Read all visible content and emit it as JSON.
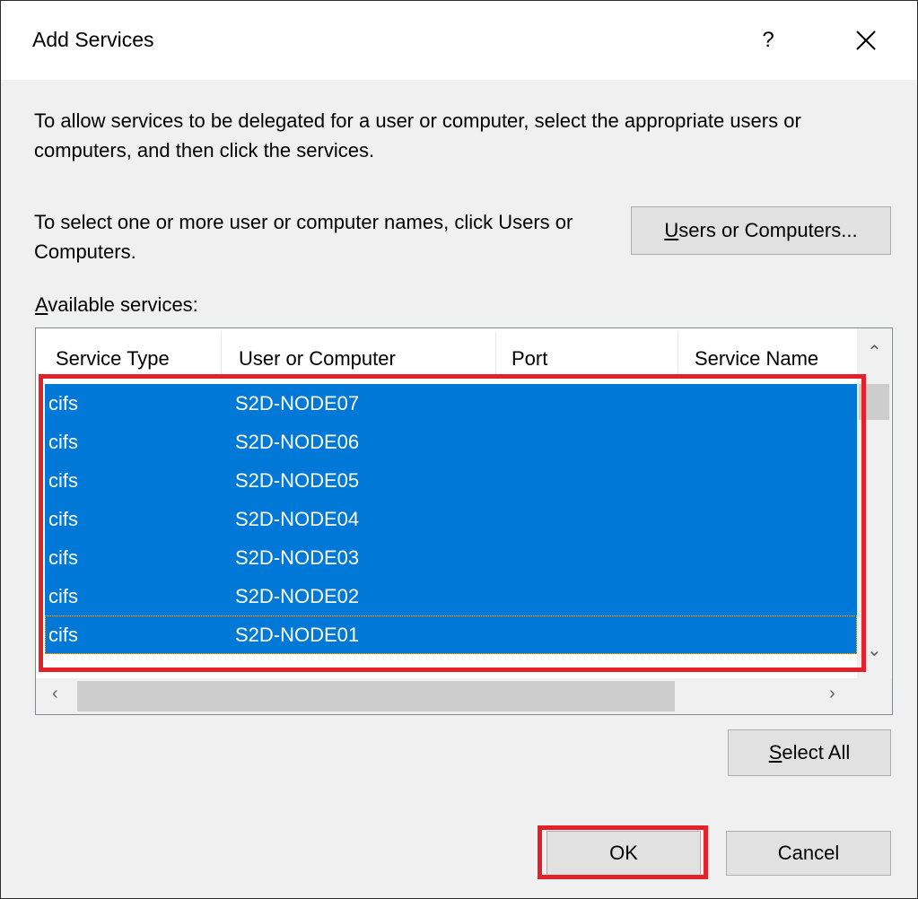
{
  "window": {
    "title": "Add Services",
    "help_glyph": "?",
    "close_label": "Close"
  },
  "description": {
    "line1": "To allow services to be delegated for a user or computer, select the appropriate users or computers, and then click the services.",
    "line2": "To select one or more user or computer names, click Users or Computers."
  },
  "buttons": {
    "users_or_computers": {
      "accel": "U",
      "rest": "sers or Computers..."
    },
    "select_all": {
      "accel": "S",
      "rest": "elect All"
    },
    "ok": "OK",
    "cancel": "Cancel"
  },
  "list": {
    "label_accel": "A",
    "label_rest": "vailable services:",
    "columns": [
      "Service Type",
      "User or Computer",
      "Port",
      "Service Name"
    ],
    "rows": [
      {
        "service_type": "cifs",
        "user_or_computer": "S2D-NODE07",
        "port": "",
        "service_name": ""
      },
      {
        "service_type": "cifs",
        "user_or_computer": "S2D-NODE06",
        "port": "",
        "service_name": ""
      },
      {
        "service_type": "cifs",
        "user_or_computer": "S2D-NODE05",
        "port": "",
        "service_name": ""
      },
      {
        "service_type": "cifs",
        "user_or_computer": "S2D-NODE04",
        "port": "",
        "service_name": ""
      },
      {
        "service_type": "cifs",
        "user_or_computer": "S2D-NODE03",
        "port": "",
        "service_name": ""
      },
      {
        "service_type": "cifs",
        "user_or_computer": "S2D-NODE02",
        "port": "",
        "service_name": ""
      },
      {
        "service_type": "cifs",
        "user_or_computer": "S2D-NODE01",
        "port": "",
        "service_name": ""
      }
    ],
    "selected_color": "#0078d7"
  },
  "annotation": {
    "highlight_color": "#e32129"
  }
}
